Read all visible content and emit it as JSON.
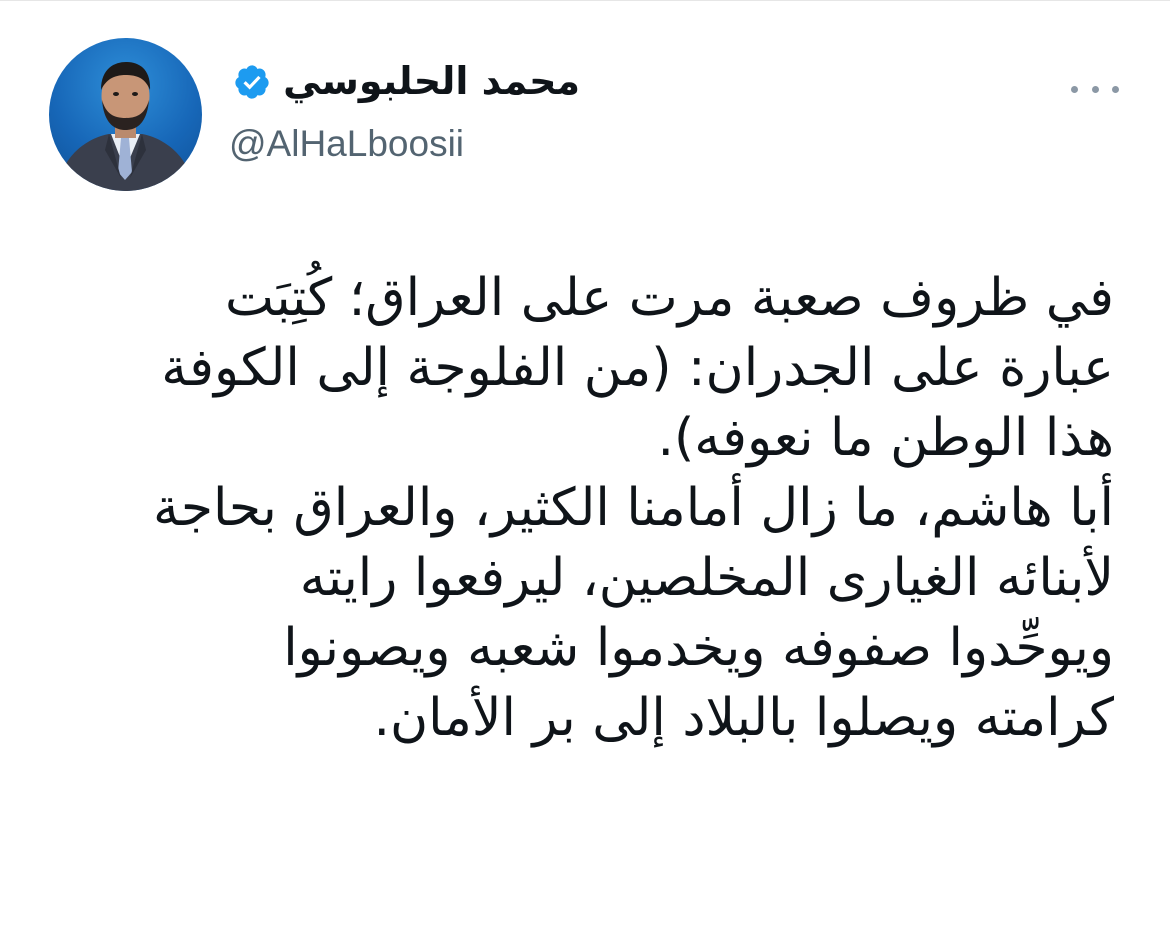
{
  "author": {
    "display_name": "محمد الحلبوسي",
    "handle": "@AlHaLboosii",
    "verified": true,
    "verified_color": "#1d9bf0"
  },
  "menu": {
    "icon": "more-horizontal-icon"
  },
  "tweet": {
    "lines": [
      "في ظروف صعبة مرت على العراق؛ كُتِبَت",
      "عبارة على الجدران: (من الفلوجة إلى الكوفة",
      "هذا الوطن ما نعوفه).",
      "أبا هاشم، ما زال أمامنا الكثير، والعراق بحاجة",
      "لأبنائه الغيارى المخلصين، ليرفعوا رايته",
      "ويوحِّدوا صفوفه ويخدموا شعبه ويصونوا",
      "كرامته ويصلوا بالبلاد إلى بر الأمان."
    ]
  },
  "colors": {
    "text": "#0f1419",
    "secondary": "#536471",
    "accent": "#1d9bf0"
  }
}
